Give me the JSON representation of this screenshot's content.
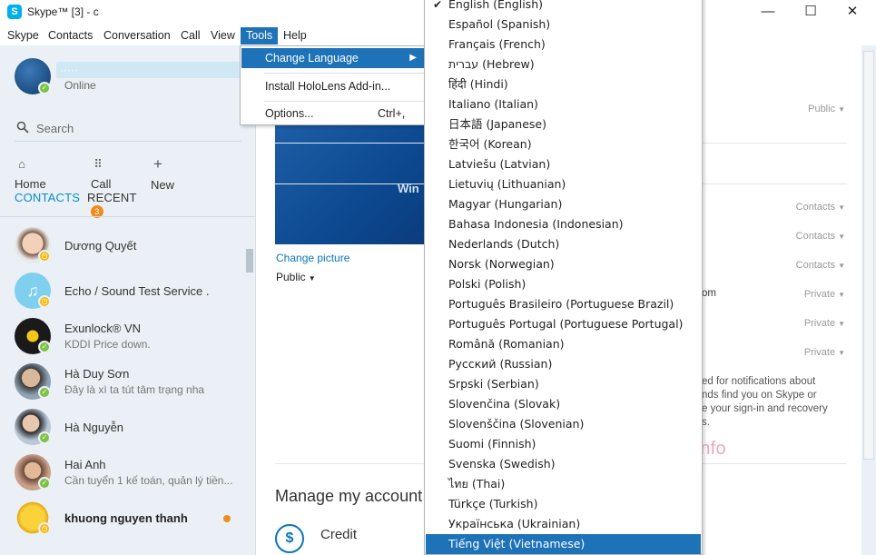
{
  "window": {
    "title": "Skype™ [3] - c",
    "app_icon": "S",
    "minimize": "—",
    "maximize": "☐",
    "close": "✕"
  },
  "menubar": [
    "Skype",
    "Contacts",
    "Conversation",
    "Call",
    "View",
    "Tools",
    "Help"
  ],
  "profile": {
    "name": "·····",
    "status": "Online"
  },
  "search": {
    "placeholder": "Search"
  },
  "nav": {
    "home": "Home",
    "call": "Call",
    "new": "New"
  },
  "tabs": {
    "contacts": "CONTACTS",
    "recent": "RECENT",
    "recent_badge": "3"
  },
  "contacts": [
    {
      "name": "Dương Quyết",
      "sub": "",
      "status": "away"
    },
    {
      "name": "Echo / Sound Test Service .",
      "sub": "",
      "status": "away"
    },
    {
      "name": "Exunlock® VN",
      "sub": "KDDI Price down.",
      "status": "online"
    },
    {
      "name": "Hà Duy Sơn",
      "sub": "Đây là xì ta tút tâm trạng nha",
      "status": "online"
    },
    {
      "name": "Hà Nguyễn",
      "sub": "",
      "status": "online"
    },
    {
      "name": "Hai Anh",
      "sub": "Cần tuyển 1 kế toán, quản lý tiền...",
      "status": "online"
    },
    {
      "name": "khuong nguyen thanh",
      "sub": "",
      "status": "away"
    }
  ],
  "main": {
    "pic_text": "Win",
    "change_picture": "Change picture",
    "public_label": "Public",
    "manage_account": "Manage my account",
    "credit": "Credit",
    "credit_icon": "$",
    "privacy": [
      {
        "label": "Public"
      },
      {
        "label": "Contacts"
      },
      {
        "label": "Contacts"
      },
      {
        "label": "Contacts"
      },
      {
        "label": "Private"
      },
      {
        "label": "Private"
      },
      {
        "label": "Private"
      }
    ],
    "email_fragment": "om",
    "notice_lines": [
      "ed for notifications about",
      "nds find you on Skype or",
      "e your sign-in and recovery",
      "s."
    ],
    "watermark": "WapMienPhi.info"
  },
  "tools_menu": {
    "change_language": "Change Language",
    "install_hololens": "Install HoloLens Add-in...",
    "options": "Options...",
    "options_shortcut": "Ctrl+,"
  },
  "languages": [
    {
      "label": "English (English)",
      "checked": true
    },
    {
      "label": "Español (Spanish)"
    },
    {
      "label": "Français (French)"
    },
    {
      "label": "עברית (Hebrew)"
    },
    {
      "label": "हिंदी (Hindi)"
    },
    {
      "label": "Italiano (Italian)"
    },
    {
      "label": "日本語 (Japanese)"
    },
    {
      "label": "한국어 (Korean)"
    },
    {
      "label": "Latviešu (Latvian)"
    },
    {
      "label": "Lietuvių (Lithuanian)"
    },
    {
      "label": "Magyar (Hungarian)"
    },
    {
      "label": "Bahasa Indonesia (Indonesian)"
    },
    {
      "label": "Nederlands (Dutch)"
    },
    {
      "label": "Norsk (Norwegian)"
    },
    {
      "label": "Polski (Polish)"
    },
    {
      "label": "Português Brasileiro (Portuguese Brazil)"
    },
    {
      "label": "Português Portugal (Portuguese Portugal)"
    },
    {
      "label": "Română (Romanian)"
    },
    {
      "label": "Русский (Russian)"
    },
    {
      "label": "Srpski (Serbian)"
    },
    {
      "label": "Slovenčina (Slovak)"
    },
    {
      "label": "Slovenščina (Slovenian)"
    },
    {
      "label": "Suomi (Finnish)"
    },
    {
      "label": "Svenska (Swedish)"
    },
    {
      "label": "ไทย (Thai)"
    },
    {
      "label": "Türkçe (Turkish)"
    },
    {
      "label": "Українська (Ukrainian)"
    },
    {
      "label": "Tiếng Việt (Vietnamese)",
      "highlighted": true
    }
  ],
  "colors": {
    "accent": "#1e72b8",
    "skype_blue": "#00aff0",
    "online": "#7cc243",
    "away": "#f8b90e",
    "badge": "#f08c1e"
  }
}
